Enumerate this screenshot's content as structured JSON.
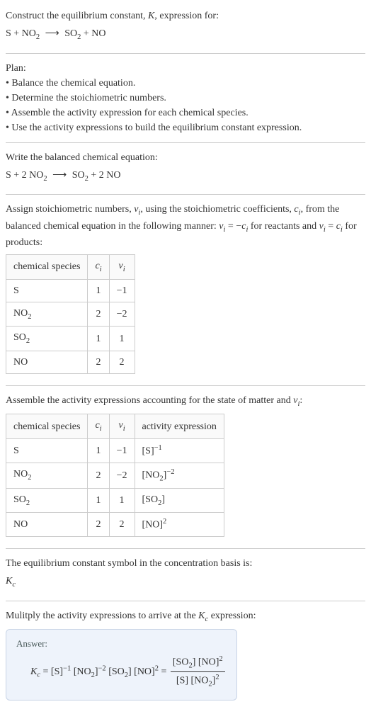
{
  "title_line1": "Construct the equilibrium constant, ",
  "title_K": "K",
  "title_line1b": ", expression for:",
  "eq_unbalanced_lhs1": "S + NO",
  "eq_unbalanced_lhs1_sub": "2",
  "eq_arrow": "⟶",
  "eq_unbalanced_rhs1": "SO",
  "eq_unbalanced_rhs1_sub": "2",
  "eq_unbalanced_rhs2": " + NO",
  "plan_heading": "Plan:",
  "plan_items": [
    "• Balance the chemical equation.",
    "• Determine the stoichiometric numbers.",
    "• Assemble the activity expression for each chemical species.",
    "• Use the activity expressions to build the equilibrium constant expression."
  ],
  "balanced_heading": "Write the balanced chemical equation:",
  "balanced_lhs1": "S + 2 NO",
  "balanced_sub1": "2",
  "balanced_rhs1": "SO",
  "balanced_rhs_sub": "2",
  "balanced_rhs2": " + 2 NO",
  "stoich_text1": "Assign stoichiometric numbers, ",
  "nu_i": "ν",
  "nu_i_sub": "i",
  "stoich_text2": ", using the stoichiometric coefficients, ",
  "c_i": "c",
  "c_i_sub": "i",
  "stoich_text3": ", from the balanced chemical equation in the following manner: ",
  "stoich_rel1": " = −",
  "stoich_text4": " for reactants and ",
  "stoich_rel2": " = ",
  "stoich_text5": " for products:",
  "table1": {
    "headers": [
      "chemical species",
      "cᵢ",
      "νᵢ"
    ],
    "rows": [
      [
        "S",
        "1",
        "−1"
      ],
      [
        "NO₂",
        "2",
        "−2"
      ],
      [
        "SO₂",
        "1",
        "1"
      ],
      [
        "NO",
        "2",
        "2"
      ]
    ]
  },
  "activity_heading": "Assemble the activity expressions accounting for the state of matter and ",
  "activity_heading2": ":",
  "table2": {
    "headers": [
      "chemical species",
      "cᵢ",
      "νᵢ",
      "activity expression"
    ],
    "rows": [
      {
        "sp": "S",
        "c": "1",
        "v": "−1",
        "expr_base": "[S]",
        "expr_sup": "−1"
      },
      {
        "sp": "NO₂",
        "c": "2",
        "v": "−2",
        "expr_base": "[NO₂]",
        "expr_sup": "−2"
      },
      {
        "sp": "SO₂",
        "c": "1",
        "v": "1",
        "expr_base": "[SO₂]",
        "expr_sup": ""
      },
      {
        "sp": "NO",
        "c": "2",
        "v": "2",
        "expr_base": "[NO]",
        "expr_sup": "2"
      }
    ]
  },
  "kc_text1": "The equilibrium constant symbol in the concentration basis is:",
  "kc_sym": "K",
  "kc_sub": "c",
  "multiply_text": "Mulitply the activity expressions to arrive at the ",
  "multiply_text2": " expression:",
  "answer_label": "Answer:",
  "answer_lhs": "K",
  "answer_lhs_sub": "c",
  "answer_eq": " = [S]",
  "answer_s1": "−1",
  "answer_p2": " [NO₂]",
  "answer_s2": "−2",
  "answer_p3": " [SO₂] [NO]",
  "answer_s3": "2",
  "answer_eq2": " = ",
  "frac_num1": "[SO₂] [NO]",
  "frac_num_sup": "2",
  "frac_den1": "[S] [NO₂]",
  "frac_den_sup": "2",
  "chart_data": {
    "type": "table",
    "tables": [
      {
        "columns": [
          "chemical species",
          "c_i",
          "ν_i"
        ],
        "rows": [
          [
            "S",
            1,
            -1
          ],
          [
            "NO2",
            2,
            -2
          ],
          [
            "SO2",
            1,
            1
          ],
          [
            "NO",
            2,
            2
          ]
        ]
      },
      {
        "columns": [
          "chemical species",
          "c_i",
          "ν_i",
          "activity expression"
        ],
        "rows": [
          [
            "S",
            1,
            -1,
            "[S]^-1"
          ],
          [
            "NO2",
            2,
            -2,
            "[NO2]^-2"
          ],
          [
            "SO2",
            1,
            1,
            "[SO2]"
          ],
          [
            "NO",
            2,
            2,
            "[NO]^2"
          ]
        ]
      }
    ]
  }
}
